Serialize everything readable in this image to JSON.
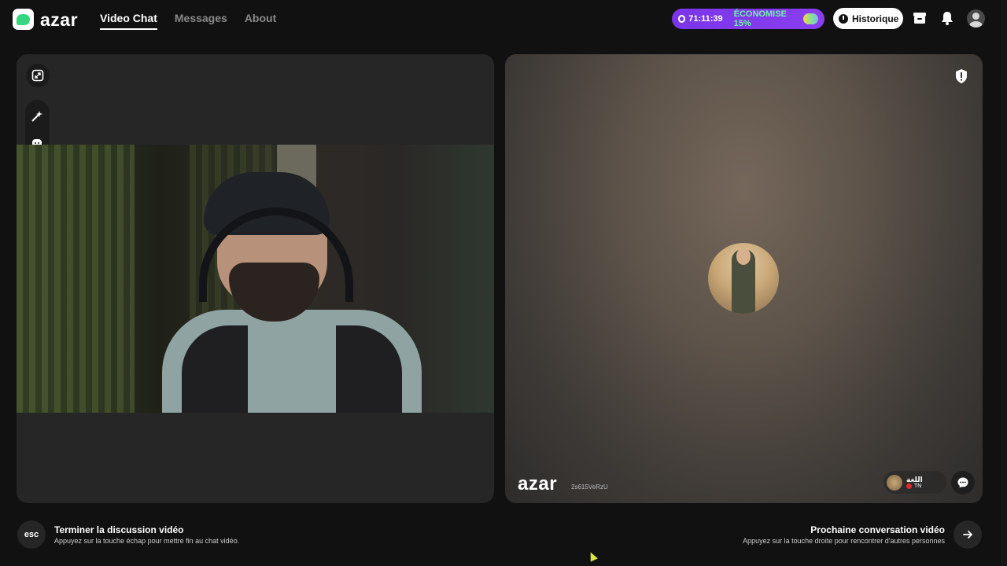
{
  "app": {
    "logo_text": "azar",
    "brand_color": "#35d67e"
  },
  "nav": {
    "items": [
      {
        "label": "Video Chat",
        "active": true
      },
      {
        "label": "Messages",
        "active": false
      },
      {
        "label": "About",
        "active": false
      }
    ]
  },
  "header": {
    "promo_timer": "71:11:39",
    "promo_text": "ÉCONOMISE 15%",
    "history_label": "Historique",
    "icons": [
      "store-icon",
      "bell-icon",
      "profile-avatar-icon"
    ]
  },
  "left_panel": {
    "tools": [
      "expand-icon",
      "magic-wand-icon",
      "face-filter-icon"
    ]
  },
  "right_panel": {
    "watermark_logo": "azar",
    "watermark_id": "2s615VeRzU",
    "peer_name": "اللغة",
    "peer_country": "TN",
    "icons": [
      "report-icon",
      "chat-bubble-icon"
    ]
  },
  "footer": {
    "esc_label": "esc",
    "end_title": "Terminer la discussion vidéo",
    "end_hint": "Appuyez sur la touche échap pour mettre fin au chat vidéo.",
    "next_title": "Prochaine conversation vidéo",
    "next_hint": "Appuyez sur la touche droite pour rencontrer d'autres personnes"
  },
  "colors": {
    "accent_purple": "#7a35e8",
    "promo_green": "#6df5a8",
    "background": "#111111"
  }
}
